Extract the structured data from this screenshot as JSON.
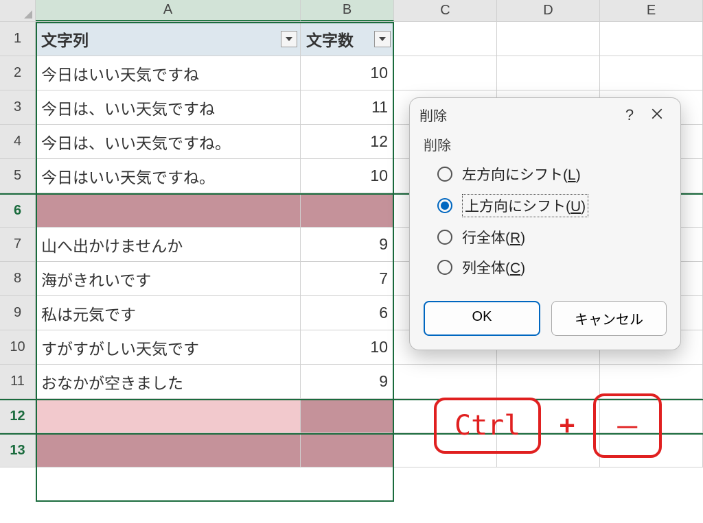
{
  "columns": [
    "A",
    "B",
    "C",
    "D",
    "E"
  ],
  "row_numbers": [
    1,
    2,
    3,
    4,
    5,
    6,
    7,
    8,
    9,
    10,
    11,
    12,
    13
  ],
  "selected_rows": [
    6,
    12,
    13
  ],
  "table": {
    "headers": {
      "a": "文字列",
      "b": "文字数"
    },
    "rows": [
      {
        "a": "今日はいい天気ですね",
        "b": "10"
      },
      {
        "a": "今日は、いい天気ですね",
        "b": "11"
      },
      {
        "a": "今日は、いい天気ですね。",
        "b": "12"
      },
      {
        "a": "今日はいい天気ですね。",
        "b": "10"
      },
      {
        "a": "",
        "b": ""
      },
      {
        "a": "山へ出かけませんか",
        "b": "9"
      },
      {
        "a": "海がきれいです",
        "b": "7"
      },
      {
        "a": "私は元気です",
        "b": "6"
      },
      {
        "a": "すがすがしい天気です",
        "b": "10"
      },
      {
        "a": "おなかが空きました",
        "b": "9"
      },
      {
        "a": "",
        "b": ""
      },
      {
        "a": "",
        "b": ""
      }
    ]
  },
  "dialog": {
    "title": "削除",
    "help": "?",
    "section_label": "削除",
    "options": {
      "shift_left_pre": "左方向にシフト(",
      "shift_left_key": "L",
      "shift_left_post": ")",
      "shift_up_pre": "上方向にシフト(",
      "shift_up_key": "U",
      "shift_up_post": ")",
      "entire_row_pre": "行全体(",
      "entire_row_key": "R",
      "entire_row_post": ")",
      "entire_col_pre": "列全体(",
      "entire_col_key": "C",
      "entire_col_post": ")"
    },
    "selected_option": "shift_up",
    "buttons": {
      "ok": "OK",
      "cancel": "キャンセル"
    }
  },
  "shortcut": {
    "key1": "Ctrl",
    "plus": "+",
    "key2": "－"
  }
}
